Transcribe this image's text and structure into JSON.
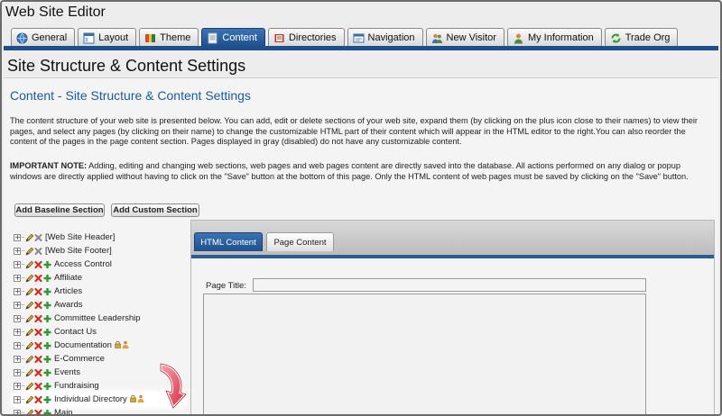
{
  "window": {
    "title": "Web Site Editor"
  },
  "tabs": [
    {
      "label": "General",
      "icon": "globe-icon"
    },
    {
      "label": "Layout",
      "icon": "layout-icon"
    },
    {
      "label": "Theme",
      "icon": "palette-icon"
    },
    {
      "label": "Content",
      "icon": "document-icon",
      "active": true
    },
    {
      "label": "Directories",
      "icon": "book-icon"
    },
    {
      "label": "Navigation",
      "icon": "navigation-icon"
    },
    {
      "label": "New Visitor",
      "icon": "people-icon"
    },
    {
      "label": "My Information",
      "icon": "person-icon"
    },
    {
      "label": "Trade Org",
      "icon": "refresh-icon"
    }
  ],
  "page": {
    "heading": "Site Structure & Content Settings",
    "section_heading": "Content - Site Structure & Content Settings",
    "description": "The content structure of your web site is presented below. You can add, edit or delete sections of your web site, expand them (by clicking on the plus icon close to their names) to view their pages, and select any pages (by clicking on their name) to change the customizable HTML part of their content which will appear in the HTML editor to the right.You can also reorder the content of the pages in the page content section. Pages displayed in gray (disabled) do not have any customizable content.",
    "note_label": "IMPORTANT NOTE:",
    "note_text": " Adding, editing and changing web sections, web pages and web pages content are directly saved into the database. All actions performed on any dialog or popup windows are directly applied without having to click on the \"Save\" button at the bottom of this page. Only the HTML content of web pages must be saved by clicking on the \"Save\" button."
  },
  "buttons": {
    "add_baseline": "Add Baseline Section",
    "add_custom": "Add Custom Section"
  },
  "tree": [
    {
      "label": "[Web Site Header]",
      "bracket": true
    },
    {
      "label": "[Web Site Footer]",
      "bracket": true
    },
    {
      "label": "Access Control"
    },
    {
      "label": "Affiliate"
    },
    {
      "label": "Articles"
    },
    {
      "label": "Awards"
    },
    {
      "label": "Committee Leadership"
    },
    {
      "label": "Contact Us"
    },
    {
      "label": "Documentation",
      "extra": true
    },
    {
      "label": "E-Commerce"
    },
    {
      "label": "Events"
    },
    {
      "label": "Fundraising"
    },
    {
      "label": "Individual Directory",
      "extra": true,
      "highlighted": true
    },
    {
      "label": "Main"
    }
  ],
  "editor": {
    "tabs": {
      "html": "HTML Content",
      "page": "Page Content"
    },
    "page_title_label": "Page Title:",
    "page_title_value": ""
  },
  "colors": {
    "accent": "#1d4f8c",
    "heading_blue": "#1a5a9e",
    "delete_red": "#d62b1e",
    "add_green": "#2e9a2e",
    "pointer_arrow": "#e8394a"
  }
}
